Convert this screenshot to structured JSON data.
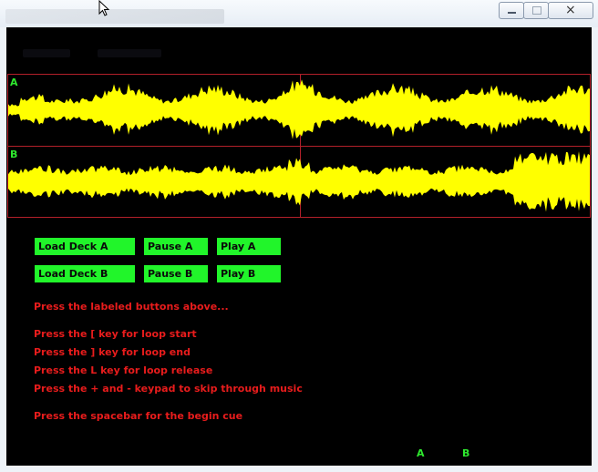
{
  "window": {
    "controls": {
      "minimize": "minimize-icon",
      "maximize": "maximize-icon",
      "close": "×"
    }
  },
  "waveform": {
    "deck_a_label": "A",
    "deck_b_label": "B",
    "wave_color": "#ffff00",
    "border_color": "#b3202a"
  },
  "buttons": {
    "load_a": "Load Deck A",
    "pause_a": "Pause A",
    "play_a": "Play A",
    "load_b": "Load Deck B",
    "pause_b": "Pause B",
    "play_b": "Play B",
    "color": "#21f52a"
  },
  "instructions": {
    "intro": "Press the labeled buttons above...",
    "loop_start": "Press the [ key for loop start",
    "loop_end": "Press the ] key for loop end",
    "loop_release": "Press the L key for loop release",
    "skip": "Press the + and - keypad to skip through music",
    "cue": "Press the spacebar for the begin cue",
    "color": "#e81c1c"
  },
  "indicators": {
    "a": "A",
    "b": "B"
  }
}
